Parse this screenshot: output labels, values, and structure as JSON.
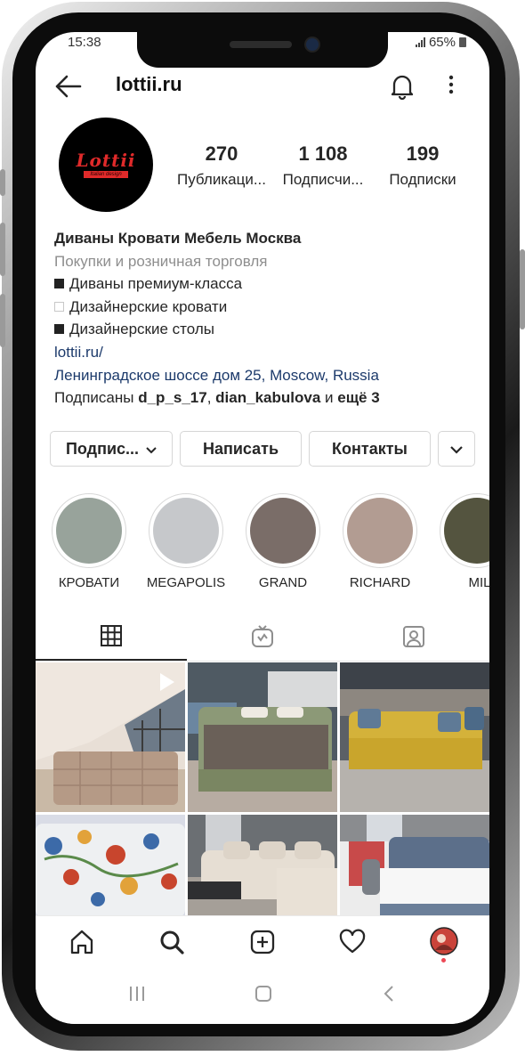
{
  "status": {
    "time": "15:38",
    "battery": "65%"
  },
  "topbar": {
    "username": "lottii.ru",
    "back_icon": "arrow-left-icon",
    "bell_icon": "bell-icon",
    "more_icon": "more-vertical-icon"
  },
  "profile": {
    "logo_text": "Lottii",
    "logo_subtext": "Italian design",
    "stats": [
      {
        "value": "270",
        "label": "Публикаци..."
      },
      {
        "value": "1 108",
        "label": "Подписчи..."
      },
      {
        "value": "199",
        "label": "Подписки"
      }
    ]
  },
  "bio": {
    "name": "Диваны Кровати Мебель Москва",
    "category": "Покупки и розничная торговля",
    "lines": [
      "Диваны премиум-класса",
      "Дизайнерские кровати",
      "Дизайнерские столы"
    ],
    "website": "lottii.ru/",
    "address": "Ленинградское шоссе дом 25, Moscow, Russia",
    "followed_prefix": "Подписаны ",
    "followed_user1": "d_p_s_17",
    "followed_sep": ", ",
    "followed_user2": "dian_kabulova",
    "followed_and": " и ",
    "followed_more": "ещё 3"
  },
  "actions": {
    "follow": "Подпис...",
    "message": "Написать",
    "contacts": "Контакты"
  },
  "highlights": [
    {
      "label": "КРОВАТИ",
      "color": "#98a39b"
    },
    {
      "label": "MEGAPOLIS",
      "color": "#c6c8cb"
    },
    {
      "label": "GRAND",
      "color": "#7a6d68"
    },
    {
      "label": "RICHARD",
      "color": "#b29c92"
    },
    {
      "label": "MILA",
      "color": "#54543f"
    }
  ],
  "tabs": [
    "grid-icon",
    "igtv-icon",
    "tagged-icon"
  ],
  "nav": [
    "home-icon",
    "search-icon",
    "add-post-icon",
    "heart-icon",
    "profile-avatar"
  ],
  "colors": {
    "link": "#1c3a6b",
    "muted": "#8e8e8e",
    "accent_dot": "#ed4956"
  }
}
